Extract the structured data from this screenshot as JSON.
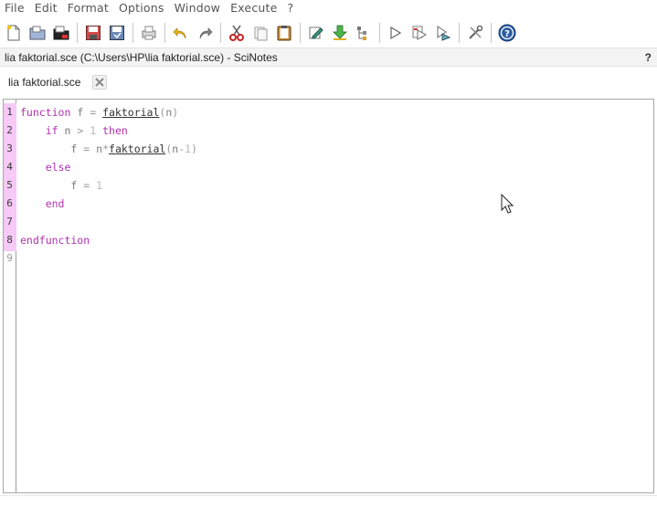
{
  "menu": {
    "items": [
      "File",
      "Edit",
      "Format",
      "Options",
      "Window",
      "Execute",
      "?"
    ]
  },
  "toolbar": {
    "buttons": [
      {
        "icon": "new-file-icon"
      },
      {
        "icon": "open-file-icon"
      },
      {
        "icon": "open-folder-icon"
      },
      {
        "icon": "save-icon"
      },
      {
        "icon": "save-as-icon"
      },
      {
        "icon": "print-icon"
      },
      {
        "icon": "undo-icon"
      },
      {
        "icon": "redo-icon"
      },
      {
        "icon": "cut-icon"
      },
      {
        "icon": "copy-icon"
      },
      {
        "icon": "paste-icon"
      },
      {
        "icon": "edit-icon"
      },
      {
        "icon": "download-icon"
      },
      {
        "icon": "list-icon"
      },
      {
        "icon": "execute-icon"
      },
      {
        "icon": "execute-file-icon"
      },
      {
        "icon": "execute-selection-icon"
      },
      {
        "icon": "preferences-icon"
      },
      {
        "icon": "help-icon"
      }
    ]
  },
  "window": {
    "title": "lia faktorial.sce (C:\\Users\\HP\\lia faktorial.sce) - SciNotes",
    "help_label": "?"
  },
  "tabs": [
    {
      "label": "lia faktorial.sce"
    }
  ],
  "editor": {
    "line_numbers": [
      "1",
      "2",
      "3",
      "4",
      "5",
      "6",
      "7",
      "8",
      "9"
    ],
    "lines": [
      "function f = faktorial(n)",
      "    if n > 1 then",
      "        f = n*faktorial(n-1)",
      "    else",
      "        f = 1",
      "    end",
      "",
      "endfunction",
      ""
    ]
  },
  "colors": {
    "keyword": "#b031b0",
    "gutter_highlight": "#f6c9f6"
  }
}
